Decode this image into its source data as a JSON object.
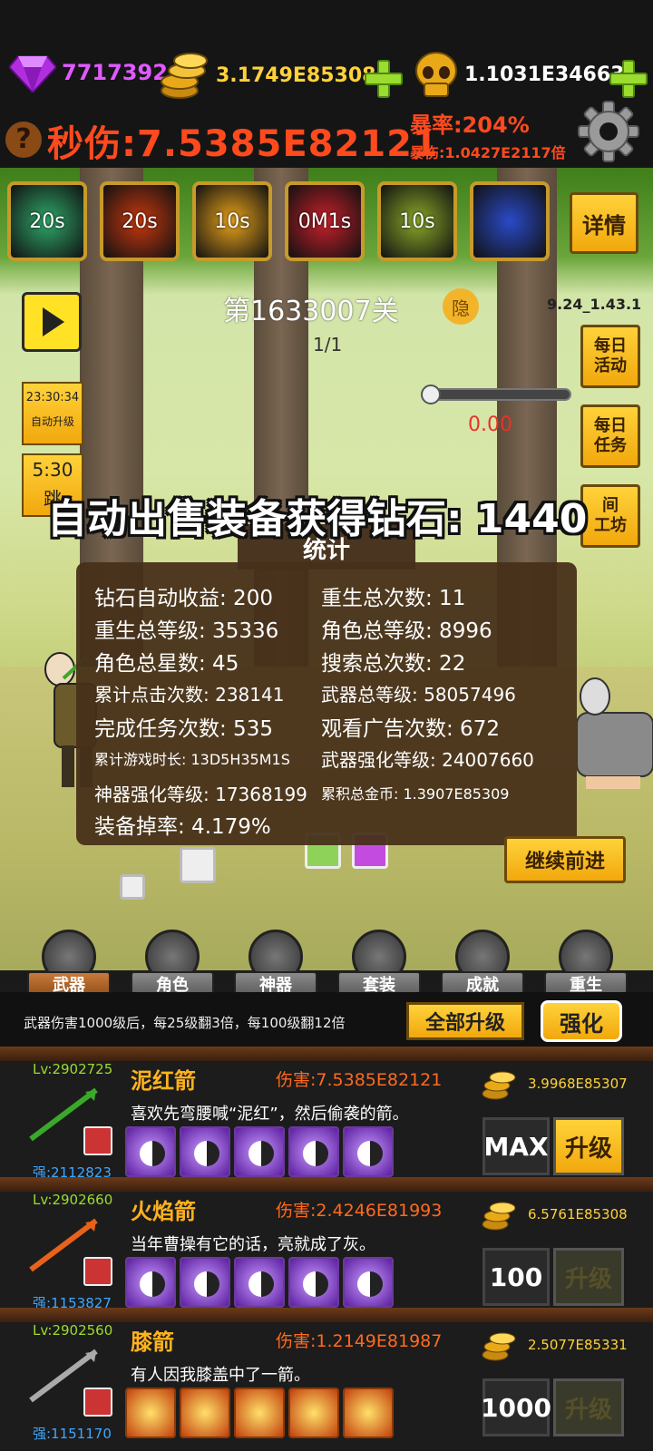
{
  "top": {
    "gems": "7717392",
    "gold": "3.1749E85308",
    "skulls": "1.1031E34663",
    "dps": "秒伤:7.5385E82121",
    "crit_rate": "暴率:204%",
    "crit_damage": "暴伤:1.0427E2117倍"
  },
  "skills": [
    {
      "label": "20s",
      "color": "#2fa86a"
    },
    {
      "label": "20s",
      "color": "#c8380e"
    },
    {
      "label": "10s",
      "color": "#e8a21a"
    },
    {
      "label": "0M1s",
      "color": "#c8202a"
    },
    {
      "label": "10s",
      "color": "#8aa828"
    },
    {
      "label": "",
      "color": "#2a4ac8"
    }
  ],
  "detail_button": "详情",
  "stage": {
    "title": "第1633007关",
    "hide_label": "隐",
    "version": "9.24_1.43.1",
    "wave": "1/1",
    "boss_hp": "0.00"
  },
  "side_buttons": {
    "daily_activity": "每日\n活动",
    "daily_task": "每日\n任务",
    "workshop": "间\n工坊"
  },
  "timer": {
    "time": "23:30:34",
    "label": "自动升级"
  },
  "skip": {
    "time": "5:30",
    "label": "跳"
  },
  "toast": "自动出售装备获得钻石: 1440",
  "stats": {
    "title": "统计",
    "items": [
      "钻石自动收益: 200",
      "重生总次数: 11",
      "重生总等级: 35336",
      "角色总等级: 8996",
      "角色总星数: 45",
      "搜索总次数: 22",
      "累计点击次数: 238141",
      "武器总等级: 58057496",
      "完成任务次数: 535",
      "观看广告次数: 672",
      "累计游戏时长: 13D5H35M1S",
      "武器强化等级: 24007660",
      "神器强化等级: 17368199",
      "累积总金币: 1.3907E85309",
      "装备掉率: 4.179%"
    ]
  },
  "continue_button": "继续前进",
  "tabs": [
    "武器",
    "角色",
    "神器",
    "套装",
    "成就",
    "重生"
  ],
  "upgrade": {
    "hint": "武器伤害1000级后，每25级翻3倍，每100级翻12倍",
    "all_upgrade": "全部升级",
    "enhance": "强化"
  },
  "weapons": [
    {
      "lv": "Lv:2902725",
      "strength": "强:2112823",
      "name": "泥红箭",
      "damage": "伤害:7.5385E82121",
      "desc": "喜欢先弯腰喊“泥红”，然后偷袭的箭。",
      "cost": "3.9968E85307",
      "qty": "MAX",
      "button": "升级",
      "enabled": true,
      "rune": "taiji",
      "arrow_color": "#3aa82a"
    },
    {
      "lv": "Lv:2902660",
      "strength": "强:1153827",
      "name": "火焰箭",
      "damage": "伤害:2.4246E81993",
      "desc": "当年曹操有它的话，亮就成了灰。",
      "cost": "6.5761E85308",
      "qty": "100",
      "button": "升级",
      "enabled": false,
      "rune": "taiji",
      "arrow_color": "#e8621a"
    },
    {
      "lv": "Lv:2902560",
      "strength": "强:1151170",
      "name": "膝箭",
      "damage": "伤害:1.2149E81987",
      "desc": "有人因我膝盖中了一箭。",
      "cost": "2.5077E85331",
      "qty": "1000",
      "button": "升级",
      "enabled": false,
      "rune": "fire",
      "arrow_color": "#aaaaaa"
    }
  ]
}
